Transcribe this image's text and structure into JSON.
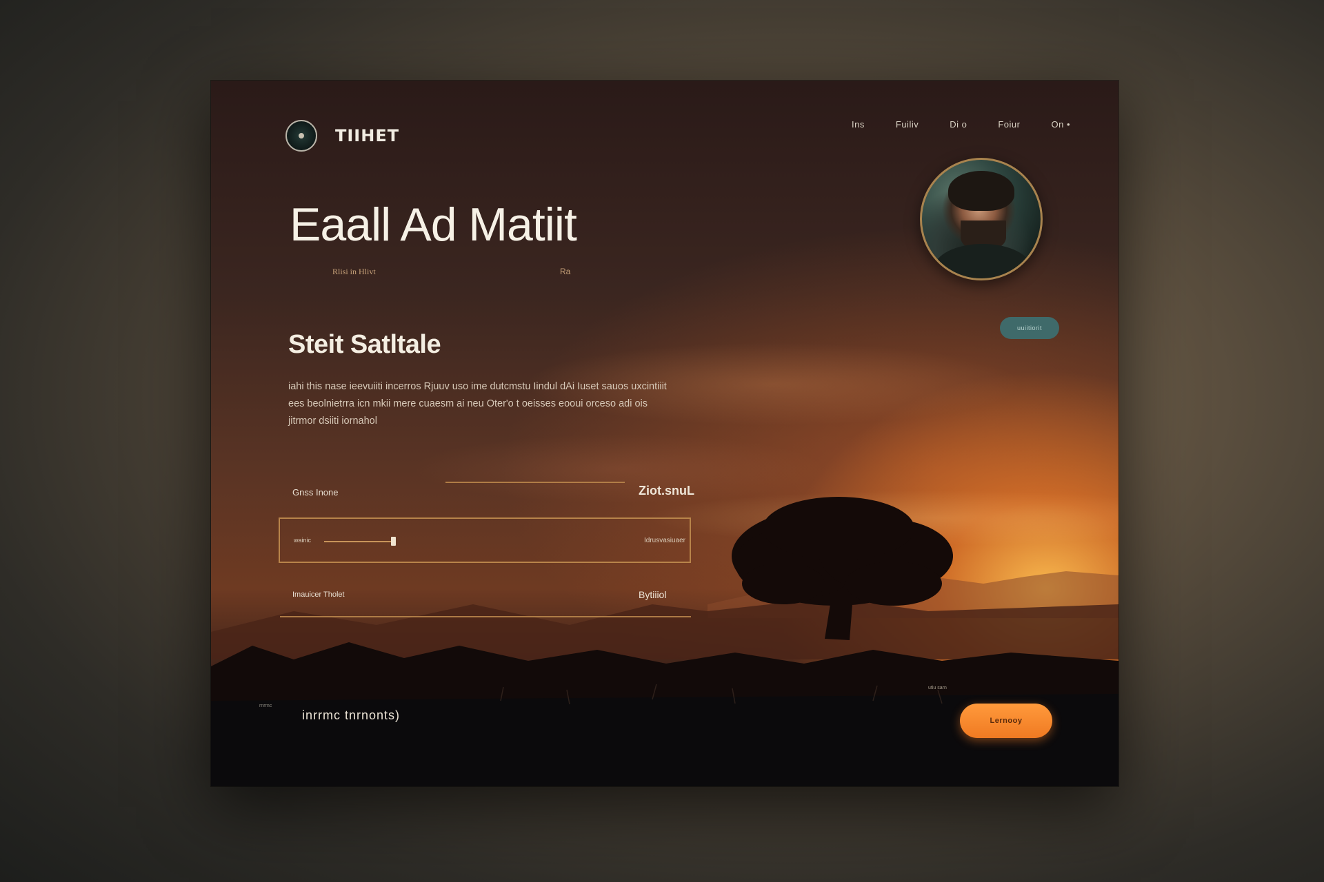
{
  "header": {
    "brand": "TIIHET",
    "nav": [
      "Ins",
      "Fuiliv",
      "Di o",
      "Foiur",
      "On •"
    ]
  },
  "hero": {
    "title": "Eaall Ad Matiit",
    "subtitle": "Rlisi in Hlivt",
    "subtitle_right": "Ra"
  },
  "tag_pill": "uuiitiorit",
  "section": {
    "title": "Steit Satltale",
    "body": "iahi this nase ieevuiiti incerros Rjuuv uso ime dutcmstu Iindul dAi Iuset sauos uxcintiiit ees beolnietrra icn mkii mere cuaesm ai neu Oter'o t oeisses eooui orceso adi ois jitrmor dsiiti iornahol"
  },
  "rows": [
    {
      "label": "Gnss Inone",
      "value": "Ziot.snuL"
    },
    {
      "label": "wainic",
      "value": "Idrusvasiuaer"
    },
    {
      "label": "Imauicer Tholet",
      "value": "Bytiiiol"
    }
  ],
  "footer": {
    "label": "inrrmc tnrnonts)",
    "mini": "rnrrnc",
    "note": "utiu sarn",
    "cta": "Lernooy"
  },
  "slider": {
    "level": 0.25
  },
  "colors": {
    "accent": "#f07a22",
    "divider": "#b8844a",
    "pill": "#3f6a6a"
  },
  "icons": {
    "logo": "logo-icon",
    "avatar": "portrait-avatar"
  }
}
